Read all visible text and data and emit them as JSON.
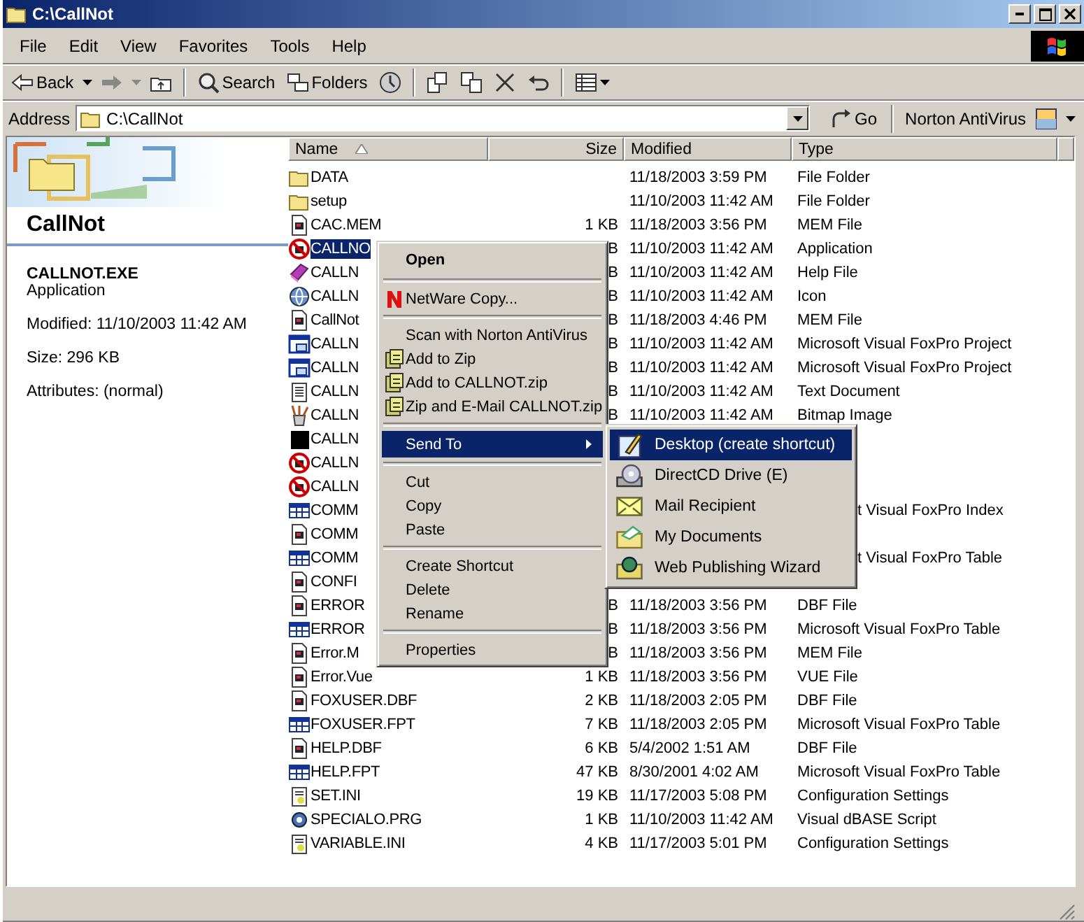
{
  "window": {
    "title": "C:\\CallNot"
  },
  "menu_bar": [
    "File",
    "Edit",
    "View",
    "Favorites",
    "Tools",
    "Help"
  ],
  "toolbar": [
    {
      "kind": "back",
      "label": "Back"
    },
    {
      "kind": "forward"
    },
    {
      "kind": "up"
    },
    {
      "kind": "separator"
    },
    {
      "kind": "search",
      "label": "Search"
    },
    {
      "kind": "folders",
      "label": "Folders"
    },
    {
      "kind": "history"
    },
    {
      "kind": "separator"
    },
    {
      "kind": "move"
    },
    {
      "kind": "copy"
    },
    {
      "kind": "delete"
    },
    {
      "kind": "undo"
    },
    {
      "kind": "separator"
    },
    {
      "kind": "views"
    }
  ],
  "address_bar": {
    "label": "Address",
    "value": "C:\\CallNot",
    "go": "Go",
    "norton": "Norton AntiVirus"
  },
  "details_panel": {
    "title": "CallNot",
    "file_name": "CALLNOT.EXE",
    "file_type": "Application",
    "modified": "Modified: 11/10/2003 11:42 AM",
    "size": "Size: 296 KB",
    "attributes": "Attributes: (normal)"
  },
  "file_list": {
    "columns": [
      {
        "label": "Name",
        "sorted": true
      },
      {
        "label": "Size",
        "sorted": false
      },
      {
        "label": "Modified",
        "sorted": false
      },
      {
        "label": "Type",
        "sorted": false
      }
    ],
    "rows": [
      {
        "kind": "folder",
        "name": "DATA",
        "modified": "11/18/2003 3:59 PM",
        "type": "File Folder",
        "selected": false
      },
      {
        "kind": "folder",
        "name": "setup",
        "modified": "11/10/2003 11:42 AM",
        "type": "File Folder",
        "selected": false
      },
      {
        "kind": "file",
        "name": "CAC.MEM",
        "size": "1 KB",
        "modified": "11/18/2003 3:56 PM",
        "type": "MEM File",
        "selected": false
      },
      {
        "kind": "exe",
        "name": "CALLNO",
        "size": "B",
        "modified": "11/10/2003 11:42 AM",
        "type": "Application",
        "selected": true
      },
      {
        "kind": "help",
        "name": "CALLN",
        "size": "B",
        "modified": "11/10/2003 11:42 AM",
        "type": "Help File",
        "selected": false
      },
      {
        "kind": "globe",
        "name": "CALLN",
        "size": "B",
        "modified": "11/10/2003 11:42 AM",
        "type": "Icon",
        "selected": false
      },
      {
        "kind": "file",
        "name": "CallNot",
        "size": "B",
        "modified": "11/18/2003 4:46 PM",
        "type": "MEM File",
        "selected": false
      },
      {
        "kind": "project",
        "name": "CALLN",
        "size": "B",
        "modified": "11/10/2003 11:42 AM",
        "type": "Microsoft Visual FoxPro Project",
        "selected": false
      },
      {
        "kind": "project",
        "name": "CALLN",
        "size": "B",
        "modified": "11/10/2003 11:42 AM",
        "type": "Microsoft Visual FoxPro Project",
        "selected": false
      },
      {
        "kind": "text",
        "name": "CALLN",
        "size": "B",
        "modified": "11/10/2003 11:42 AM",
        "type": "Text Document",
        "selected": false
      },
      {
        "kind": "paint",
        "name": "CALLN",
        "size": "B",
        "modified": "11/10/2003 11:42 AM",
        "type": "Bitmap Image",
        "selected": false
      },
      {
        "kind": "black",
        "name": "CALLN",
        "selected": false
      },
      {
        "kind": "exe",
        "name": "CALLN",
        "selected": false
      },
      {
        "kind": "exe",
        "name": "CALLN",
        "selected": false
      },
      {
        "kind": "table",
        "name": "COMM",
        "type": "t Visual FoxPro Index",
        "selected": false
      },
      {
        "kind": "file",
        "name": "COMM",
        "selected": false
      },
      {
        "kind": "table",
        "name": "COMM",
        "type": "t Visual FoxPro Table",
        "selected": false
      },
      {
        "kind": "file",
        "name": "CONFI",
        "selected": false
      },
      {
        "kind": "file",
        "name": "ERROR",
        "size": "B",
        "modified": "11/18/2003 3:56 PM",
        "type": "DBF File",
        "selected": false
      },
      {
        "kind": "table",
        "name": "ERROR",
        "size": "B",
        "modified": "11/18/2003 3:56 PM",
        "type": "Microsoft Visual FoxPro Table",
        "selected": false
      },
      {
        "kind": "file",
        "name": "Error.M",
        "size": "B",
        "modified": "11/18/2003 3:56 PM",
        "type": "MEM File",
        "selected": false
      },
      {
        "kind": "file",
        "name": "Error.Vue",
        "size": "1 KB",
        "modified": "11/18/2003 3:56 PM",
        "type": "VUE File",
        "selected": false
      },
      {
        "kind": "file",
        "name": "FOXUSER.DBF",
        "size": "2 KB",
        "modified": "11/18/2003 2:05 PM",
        "type": "DBF File",
        "selected": false
      },
      {
        "kind": "table",
        "name": "FOXUSER.FPT",
        "size": "7 KB",
        "modified": "11/18/2003 2:05 PM",
        "type": "Microsoft Visual FoxPro Table",
        "selected": false
      },
      {
        "kind": "file",
        "name": "HELP.DBF",
        "size": "6 KB",
        "modified": "5/4/2002 1:51 AM",
        "type": "DBF File",
        "selected": false
      },
      {
        "kind": "table",
        "name": "HELP.FPT",
        "size": "47 KB",
        "modified": "8/30/2001 4:02 AM",
        "type": "Microsoft Visual FoxPro Table",
        "selected": false
      },
      {
        "kind": "ini",
        "name": "SET.INI",
        "size": "19 KB",
        "modified": "11/17/2003 5:08 PM",
        "type": "Configuration Settings",
        "selected": false
      },
      {
        "kind": "script",
        "name": "SPECIALO.PRG",
        "size": "1 KB",
        "modified": "11/10/2003 11:42 AM",
        "type": "Visual dBASE Script",
        "selected": false
      },
      {
        "kind": "ini",
        "name": "VARIABLE.INI",
        "size": "4 KB",
        "modified": "11/17/2003 5:01 PM",
        "type": "Configuration Settings",
        "selected": false
      }
    ]
  },
  "context_menu": {
    "items": [
      {
        "kind": "item",
        "label": "Open",
        "default": true,
        "selected": false
      },
      {
        "kind": "separator"
      },
      {
        "kind": "item",
        "label": "NetWare Copy...",
        "default": false,
        "selected": false
      },
      {
        "kind": "separator"
      },
      {
        "kind": "item",
        "label": "Scan with Norton AntiVirus",
        "default": false,
        "selected": false
      },
      {
        "kind": "item",
        "label": "Add to Zip",
        "default": false,
        "selected": false
      },
      {
        "kind": "item",
        "label": "Add to CALLNOT.zip",
        "default": false,
        "selected": false
      },
      {
        "kind": "item",
        "label": "Zip and E-Mail CALLNOT.zip",
        "default": false,
        "selected": false
      },
      {
        "kind": "separator"
      },
      {
        "kind": "submenu",
        "label": "Send To",
        "default": false,
        "selected": true
      },
      {
        "kind": "separator"
      },
      {
        "kind": "item",
        "label": "Cut",
        "default": false,
        "selected": false
      },
      {
        "kind": "item",
        "label": "Copy",
        "default": false,
        "selected": false
      },
      {
        "kind": "item",
        "label": "Paste",
        "default": false,
        "selected": false
      },
      {
        "kind": "separator"
      },
      {
        "kind": "item",
        "label": "Create Shortcut",
        "default": false,
        "selected": false
      },
      {
        "kind": "item",
        "label": "Delete",
        "default": false,
        "selected": false
      },
      {
        "kind": "item",
        "label": "Rename",
        "default": false,
        "selected": false
      },
      {
        "kind": "separator"
      },
      {
        "kind": "item",
        "label": "Properties",
        "default": false,
        "selected": false
      }
    ]
  },
  "send_to_menu": {
    "items": [
      {
        "label": "Desktop (create shortcut)",
        "selected": true
      },
      {
        "label": "DirectCD Drive (E)",
        "selected": false
      },
      {
        "label": "Mail Recipient",
        "selected": false
      },
      {
        "label": "My Documents",
        "selected": false
      },
      {
        "label": "Web Publishing Wizard",
        "selected": false
      }
    ]
  }
}
